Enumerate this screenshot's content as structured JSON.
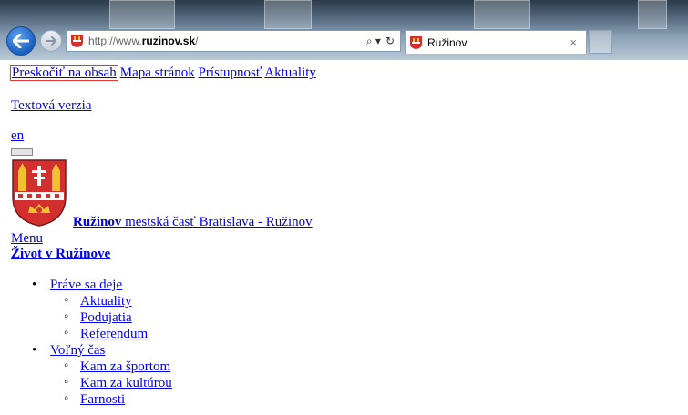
{
  "browser": {
    "url_prefix": "http://www.",
    "url_domain": "ruzinov.sk",
    "url_suffix": "/",
    "tab_title": "Ružinov",
    "tab_close": "×",
    "search_glyph": "⌕ ▾",
    "refresh_glyph": "↻"
  },
  "top_links": [
    {
      "label": "Preskočiť na obsah"
    },
    {
      "label": "Mapa stránok"
    },
    {
      "label": "Prístupnosť"
    },
    {
      "label": "Aktuality"
    }
  ],
  "text_version": "Textová verzia",
  "language": "en",
  "site": {
    "name_bold": "Ružinov",
    "name_rest": " mestská časť Bratislava - Ružinov"
  },
  "menu_label": "Menu",
  "life_heading": "Život v Ružinove",
  "nav": [
    {
      "label": "Práve sa deje",
      "children": [
        "Aktuality",
        "Podujatia",
        "Referendum"
      ]
    },
    {
      "label": "Voľný čas",
      "children": [
        "Kam za športom",
        "Kam za kultúrou",
        "Farnosti"
      ]
    }
  ],
  "colors": {
    "link": "#0000ee",
    "focus_outline": "#e53935",
    "back_button": "#1a5fc2",
    "crest_red": "#d32f2f",
    "crest_gold": "#f2c12e"
  }
}
